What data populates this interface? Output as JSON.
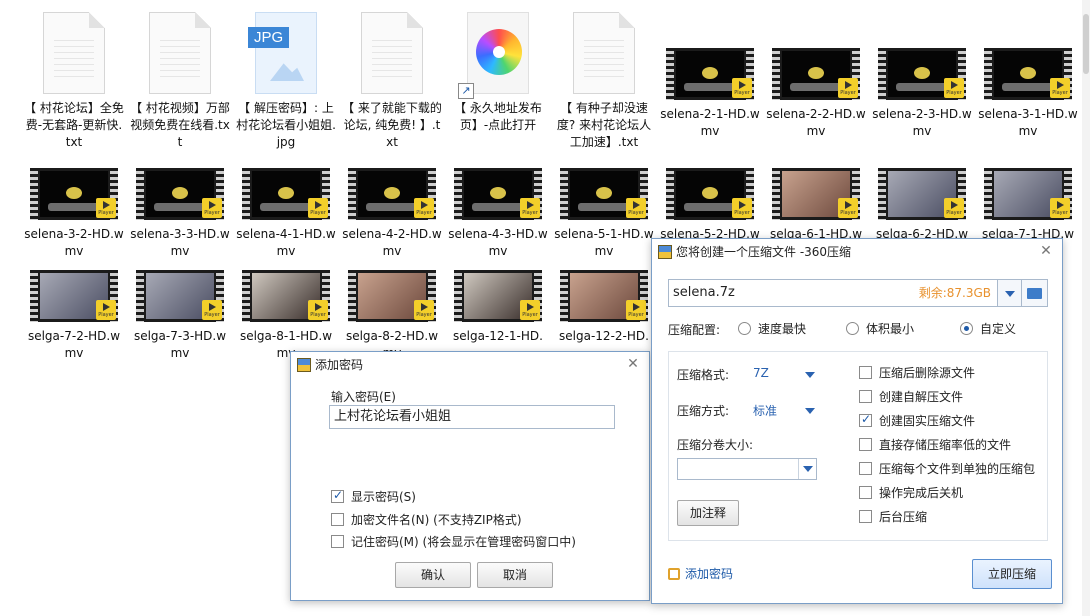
{
  "files": {
    "row1": [
      {
        "name": "【 村花论坛】全免费-无套路-更新快.txt",
        "type": "txt"
      },
      {
        "name": "【 村花视频】万部视频免费在线看.txt",
        "type": "txt"
      },
      {
        "name": "【 解压密码】: 上村花论坛看小姐姐.jpg",
        "type": "jpg",
        "tag": "JPG"
      },
      {
        "name": "【 来了就能下载的论坛, 纯免费! 】.txt",
        "type": "txt"
      },
      {
        "name": "【 永久地址发布页】-点此打开",
        "type": "exe"
      },
      {
        "name": "【 有种子却没速度? 来村花论坛人工加速】.txt",
        "type": "txt"
      },
      {
        "name": "selena-2-1-HD.wmv",
        "type": "video"
      },
      {
        "name": "selena-2-2-HD.wmv",
        "type": "video"
      },
      {
        "name": "selena-2-3-HD.wmv",
        "type": "video"
      },
      {
        "name": "selena-3-1-HD.wmv",
        "type": "video"
      }
    ],
    "row2": [
      {
        "name": "selena-3-2-HD.wmv"
      },
      {
        "name": "selena-3-3-HD.wmv"
      },
      {
        "name": "selena-4-1-HD.wmv"
      },
      {
        "name": "selena-4-2-HD.wmv"
      },
      {
        "name": "selena-4-3-HD.wmv"
      },
      {
        "name": "selena-5-1-HD.wmv"
      },
      {
        "name": "selena-5-2-HD.wmv"
      },
      {
        "name": "selga-6-1-HD.wmv"
      },
      {
        "name": "selga-6-2-HD.wmv"
      },
      {
        "name": "selga-7-1-HD.wmv"
      }
    ],
    "row3": [
      {
        "name": "selga-7-2-HD.wmv"
      },
      {
        "name": "selga-7-3-HD.wmv"
      },
      {
        "name": "selga-8-1-HD.wmv"
      },
      {
        "name": "selga-8-2-HD.wmv"
      },
      {
        "name": "selga-12-1-HD."
      },
      {
        "name": "selga-12-2-HD."
      }
    ],
    "player_badge": "Player"
  },
  "password_dialog": {
    "title": "添加密码",
    "close": "✕",
    "input_label": "输入密码(E)",
    "input_value": "上村花论坛看小姐姐",
    "options": [
      {
        "label": "显示密码(S)",
        "checked": true
      },
      {
        "label": "加密文件名(N) (不支持ZIP格式)",
        "checked": false
      },
      {
        "label": "记住密码(M) (将会显示在管理密码窗口中)",
        "checked": false
      }
    ],
    "ok": "确认",
    "cancel": "取消"
  },
  "compress_dialog": {
    "title": "您将创建一个压缩文件 -360压缩",
    "close": "✕",
    "filename": "selena.7z",
    "free_space": "剩余:87.3GB",
    "free_space_color": "#e8912d",
    "config_label": "压缩配置:",
    "modes": [
      {
        "label": "速度最快",
        "checked": false
      },
      {
        "label": "体积最小",
        "checked": false
      },
      {
        "label": "自定义",
        "checked": true
      }
    ],
    "format_label": "压缩格式:",
    "format_value": "7Z",
    "method_label": "压缩方式:",
    "method_value": "标准",
    "split_label": "压缩分卷大小:",
    "comment_button": "加注释",
    "options": [
      {
        "label": "压缩后删除源文件",
        "checked": false
      },
      {
        "label": "创建自解压文件",
        "checked": false
      },
      {
        "label": "创建固实压缩文件",
        "checked": true
      },
      {
        "label": "直接存储压缩率低的文件",
        "checked": false
      },
      {
        "label": "压缩每个文件到单独的压缩包",
        "checked": false
      },
      {
        "label": "操作完成后关机",
        "checked": false
      },
      {
        "label": "后台压缩",
        "checked": false
      }
    ],
    "add_password_link": "添加密码",
    "compress_button": "立即压缩"
  }
}
